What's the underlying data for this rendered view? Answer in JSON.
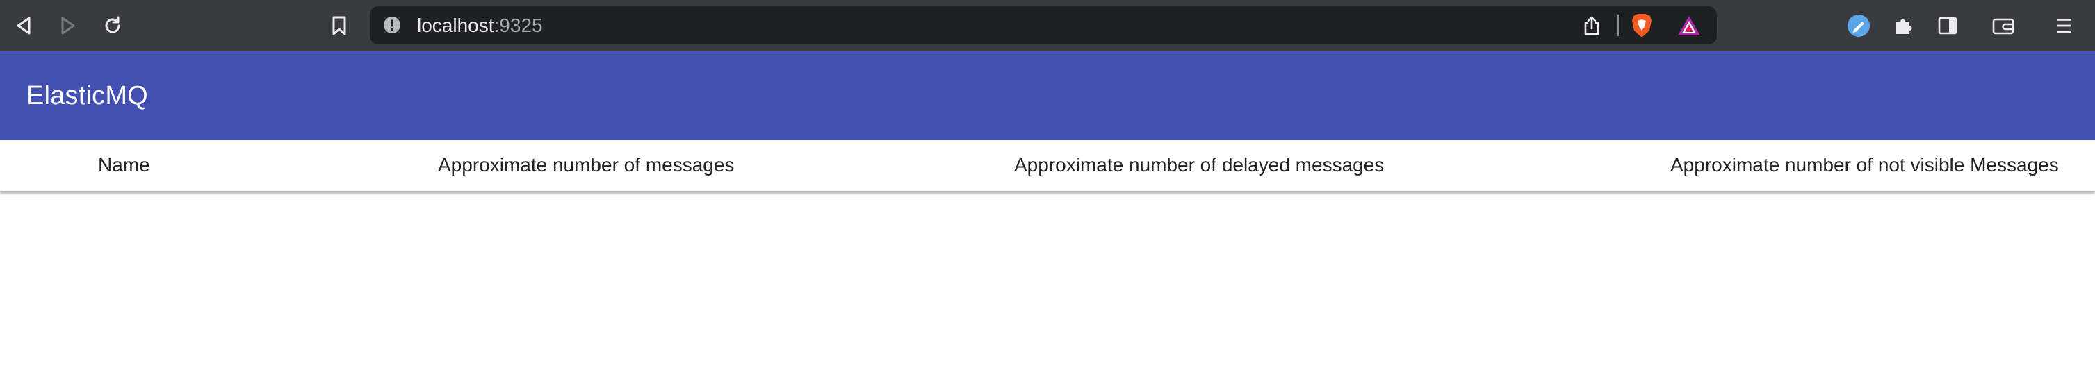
{
  "browser": {
    "url_host": "localhost",
    "url_port": ":9325",
    "icons": {
      "back": "back-arrow-icon",
      "forward": "forward-arrow-icon",
      "reload": "reload-icon",
      "bookmark": "bookmark-icon",
      "site_info": "info-icon",
      "share": "share-icon",
      "brave_shields": "brave-lion-icon",
      "rewards": "brave-rewards-triangle-icon",
      "extension_profile": "extension-avatar-icon",
      "extensions": "puzzle-piece-icon",
      "sidebar": "sidebar-toggle-icon",
      "wallet": "wallet-icon",
      "menu": "hamburger-menu-icon"
    },
    "colors": {
      "toolbar": "#3a3b40",
      "urlbar": "#1f2024"
    }
  },
  "app": {
    "title": "ElasticMQ",
    "bar_color": "#4350b2"
  },
  "table": {
    "columns": [
      "Name",
      "Approximate number of messages",
      "Approximate number of delayed messages",
      "Approximate number of not visible Messages"
    ],
    "rows": []
  }
}
